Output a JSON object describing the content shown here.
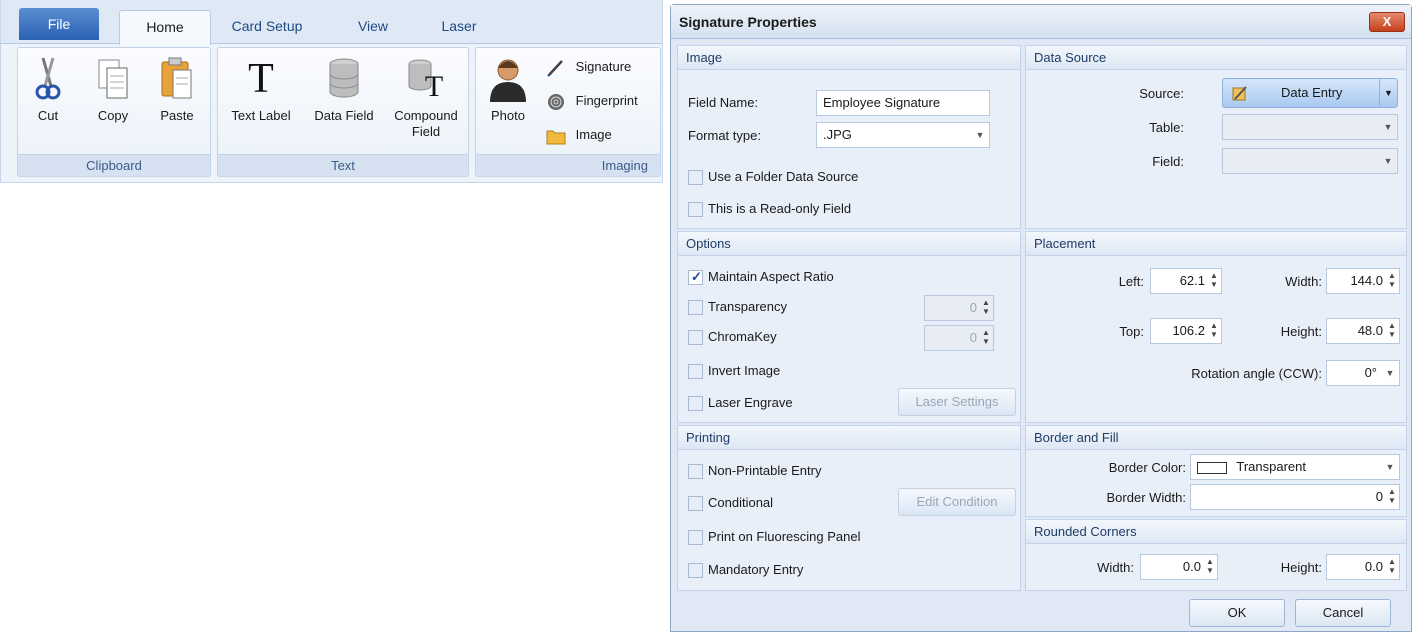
{
  "ribbon": {
    "tabs": [
      "File",
      "Home",
      "Card Setup",
      "View",
      "Laser"
    ],
    "groups": {
      "clipboard": {
        "label": "Clipboard",
        "cut": "Cut",
        "copy": "Copy",
        "paste": "Paste"
      },
      "text": {
        "label": "Text",
        "text_label": "Text Label",
        "data_field": "Data Field",
        "compound_field_1": "Compound",
        "compound_field_2": "Field"
      },
      "imaging": {
        "label": "Imaging",
        "photo": "Photo",
        "signature": "Signature",
        "fingerprint": "Fingerprint",
        "image": "Image"
      }
    }
  },
  "dialog": {
    "title": "Signature Properties",
    "close_label": "X",
    "image": {
      "header": "Image",
      "field_name_label": "Field Name:",
      "field_name_value": "Employee Signature",
      "format_type_label": "Format type:",
      "format_type_value": ".JPG",
      "folder_source": "Use a Folder Data Source",
      "read_only": "This is a Read-only Field"
    },
    "data_source": {
      "header": "Data Source",
      "source_label": "Source:",
      "source_value": "Data Entry",
      "table_label": "Table:",
      "field_label": "Field:"
    },
    "options": {
      "header": "Options",
      "maintain_aspect": "Maintain Aspect Ratio",
      "transparency": "Transparency",
      "transparency_value": "0",
      "chromakey": "ChromaKey",
      "chromakey_value": "0",
      "invert": "Invert Image",
      "laser_engrave": "Laser Engrave",
      "laser_settings": "Laser Settings"
    },
    "placement": {
      "header": "Placement",
      "left_label": "Left:",
      "left_value": "62.1",
      "width_label": "Width:",
      "width_value": "144.0",
      "top_label": "Top:",
      "top_value": "106.2",
      "height_label": "Height:",
      "height_value": "48.0",
      "rotation_label": "Rotation angle (CCW):",
      "rotation_value": "0°"
    },
    "printing": {
      "header": "Printing",
      "non_printable": "Non-Printable Entry",
      "conditional": "Conditional",
      "edit_condition": "Edit Condition",
      "fluorescing": "Print on Fluorescing Panel",
      "mandatory": "Mandatory Entry"
    },
    "border_fill": {
      "header": "Border and Fill",
      "color_label": "Border Color:",
      "color_value": "Transparent",
      "width_label": "Border Width:",
      "width_value": "0"
    },
    "rounded": {
      "header": "Rounded Corners",
      "width_label": "Width:",
      "width_value": "0.0",
      "height_label": "Height:",
      "height_value": "0.0"
    },
    "ok": "OK",
    "cancel": "Cancel"
  }
}
